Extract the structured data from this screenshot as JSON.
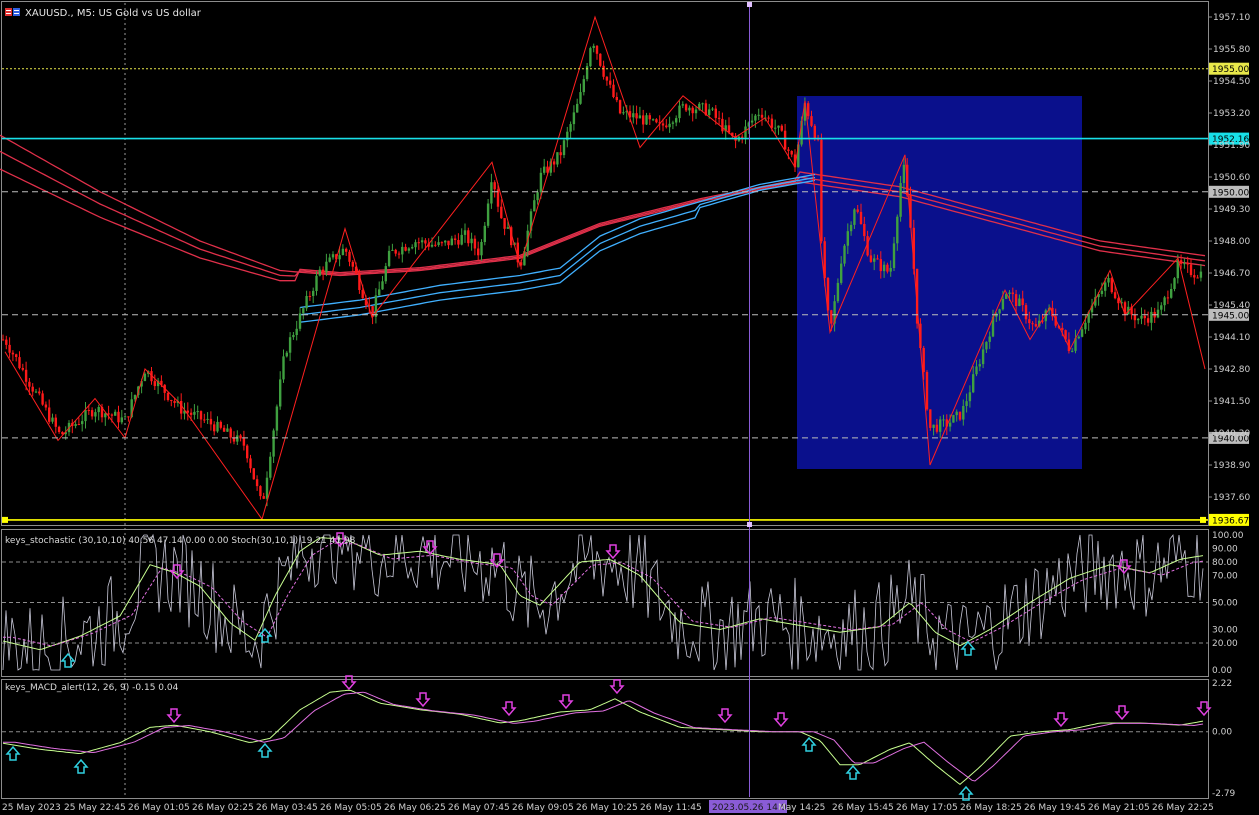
{
  "window": {
    "symbol_title": "XAUUSD., M5:  US Gold vs US dollar"
  },
  "main_panel": {
    "price_ticks": [
      "1957.10",
      "1955.80",
      "1954.50",
      "1953.20",
      "1951.90",
      "1950.60",
      "1949.30",
      "1948.00",
      "1946.70",
      "1945.40",
      "1944.10",
      "1942.80",
      "1941.50",
      "1940.20",
      "1938.90",
      "1937.60"
    ],
    "levels": [
      {
        "label": "1955.00",
        "value": 1955.0,
        "color": "#e8e84a",
        "style": "dotted"
      },
      {
        "label": "1952.16",
        "value": 1952.16,
        "color": "#18e0e8",
        "style": "solid"
      },
      {
        "label": "1950.00",
        "value": 1950.0,
        "color": "#bdbdbd",
        "style": "dashed"
      },
      {
        "label": "1945.00",
        "value": 1945.0,
        "color": "#bdbdbd",
        "style": "dashed"
      },
      {
        "label": "1940.00",
        "value": 1940.0,
        "color": "#bdbdbd",
        "style": "dashed"
      },
      {
        "label": "1936.67",
        "value": 1936.67,
        "color": "#ffff00",
        "style": "solid"
      }
    ]
  },
  "stoch_panel": {
    "title": "keys_stochastic (30,10,10) 40.56 47.14 0.00 0.00 Stoch(30,10,1) 19.21 41.98",
    "ticks": [
      "100.00",
      "90.00",
      "80.00",
      "70.00",
      "50.00",
      "30.00",
      "20.00",
      "0.00"
    ]
  },
  "macd_panel": {
    "title": "keys_MACD_alert(12, 26, 9) -0.15 0.04",
    "ticks": [
      "2.22",
      "0.00",
      "-2.79"
    ]
  },
  "time_axis": {
    "labels": [
      "25 May 2023",
      "25 May 22:45",
      "26 May 01:05",
      "26 May 02:25",
      "26 May 03:45",
      "26 May 05:05",
      "26 May 06:25",
      "26 May 07:45",
      "26 May 09:05",
      "26 May 10:25",
      "26 May 11:45",
      "2023.05.26 14:00",
      "May 14:25",
      "26 May 15:45",
      "26 May 17:05",
      "26 May 18:25",
      "26 May 19:45",
      "26 May 21:05",
      "26 May 22:25"
    ],
    "cursor_label": "2023.05.26 14:00"
  },
  "colors": {
    "bull": "#3fa040",
    "bear": "#ff1a1a",
    "zigzag": "#ff2020",
    "ma_red": "#e0304a",
    "ma_blue": "#40b0ff",
    "box": "#0a108c",
    "cursor": "#8a5cd6",
    "arrow_down": "#e040e0",
    "arrow_up": "#30d0e0"
  },
  "icons": {
    "chart_icon": "flag-icon"
  }
}
